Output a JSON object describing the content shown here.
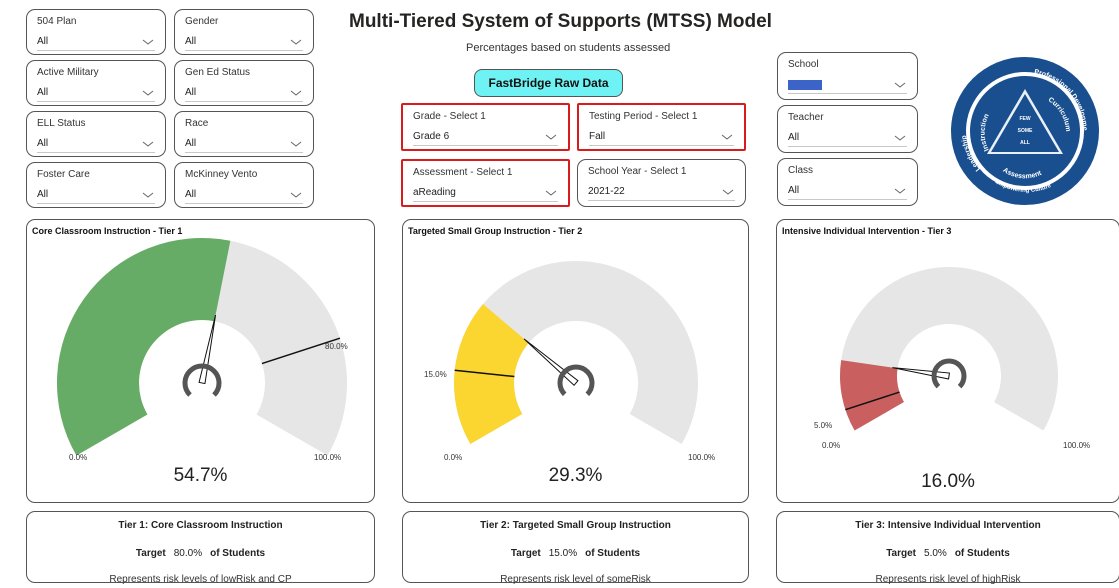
{
  "title": "Multi-Tiered System of Supports (MTSS) Model",
  "subtitle": "Percentages based on students assessed",
  "raw_data_button": "FastBridge Raw Data",
  "filters_left": [
    {
      "label": "504 Plan",
      "value": "All"
    },
    {
      "label": "Gender",
      "value": "All"
    },
    {
      "label": "Active Military",
      "value": "All"
    },
    {
      "label": "Gen Ed Status",
      "value": "All"
    },
    {
      "label": "ELL Status",
      "value": "All"
    },
    {
      "label": "Race",
      "value": "All"
    },
    {
      "label": "Foster Care",
      "value": "All"
    },
    {
      "label": "McKinney Vento",
      "value": "All"
    }
  ],
  "filters_center": {
    "grade": {
      "label": "Grade - Select 1",
      "value": "Grade 6"
    },
    "testing_period": {
      "label": "Testing Period - Select 1",
      "value": "Fall"
    },
    "assessment": {
      "label": "Assessment - Select 1",
      "value": "aReading"
    },
    "school_year": {
      "label": "School Year - Select 1",
      "value": "2021-22"
    }
  },
  "filters_right": {
    "school": {
      "label": "School",
      "value": ""
    },
    "teacher": {
      "label": "Teacher",
      "value": "All"
    },
    "class": {
      "label": "Class",
      "value": "All"
    }
  },
  "logo": {
    "outer_top": "Professional Development",
    "left": "Leadership",
    "bottom": "Empowering Culture",
    "inner_left": "Instruction",
    "inner_right": "Curriculum",
    "inner_bottom": "Assessment",
    "tri_1": "FEW",
    "tri_2": "SOME",
    "tri_3": "ALL"
  },
  "colors": {
    "tier1": "#66ac67",
    "tier2": "#fbd631",
    "tier3": "#c9605f",
    "gauge_bg": "#e6e6e6",
    "button": "#6ff2f3",
    "highlight": "#d81c1c"
  },
  "chart_data": [
    {
      "type": "gauge",
      "title": "Core Classroom Instruction - Tier 1",
      "value": 54.7,
      "value_label": "54.7%",
      "target": 80.0,
      "target_label": "80.0%",
      "min_label": "0.0%",
      "max_label": "100.0%",
      "min": 0,
      "max": 100
    },
    {
      "type": "gauge",
      "title": "Targeted Small Group Instruction - Tier 2",
      "value": 29.3,
      "value_label": "29.3%",
      "target": 15.0,
      "target_label": "15.0%",
      "min_label": "0.0%",
      "max_label": "100.0%",
      "min": 0,
      "max": 100
    },
    {
      "type": "gauge",
      "title": "Intensive Individual Intervention - Tier 3",
      "value": 16.0,
      "value_label": "16.0%",
      "target": 5.0,
      "target_label": "5.0%",
      "min_label": "0.0%",
      "max_label": "100.0%",
      "min": 0,
      "max": 100
    }
  ],
  "info_cards": [
    {
      "title": "Tier 1:  Core Classroom Instruction",
      "target_word": "Target",
      "target_value": "80.0%",
      "target_suffix": "of Students",
      "risk": "Represents risk levels of lowRisk and CP"
    },
    {
      "title": "Tier 2:  Targeted Small Group Instruction",
      "target_word": "Target",
      "target_value": "15.0%",
      "target_suffix": "of Students",
      "risk": "Represents risk level of someRisk"
    },
    {
      "title": "Tier 3:  Intensive Individual Intervention",
      "target_word": "Target",
      "target_value": "5.0%",
      "target_suffix": "of Students",
      "risk": "Represents risk level of highRisk"
    }
  ]
}
